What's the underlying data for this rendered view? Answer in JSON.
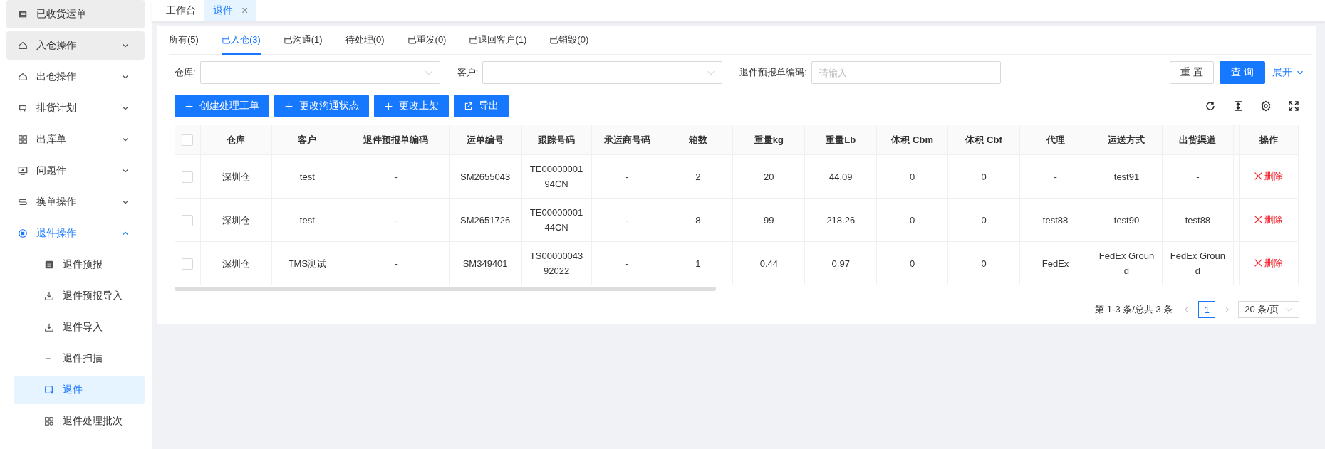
{
  "sidebar": {
    "items": [
      {
        "label": "已收货运单",
        "kind": "link",
        "highlighted": true,
        "selected": false
      },
      {
        "label": "入仓操作",
        "kind": "group",
        "highlighted": true,
        "expanded": false
      },
      {
        "label": "出仓操作",
        "kind": "group",
        "highlighted": false,
        "expanded": false
      },
      {
        "label": "排货计划",
        "kind": "group",
        "highlighted": false,
        "expanded": false
      },
      {
        "label": "出库单",
        "kind": "group",
        "highlighted": false,
        "expanded": false
      },
      {
        "label": "问题件",
        "kind": "group",
        "highlighted": false,
        "expanded": false
      },
      {
        "label": "换单操作",
        "kind": "group",
        "highlighted": false,
        "expanded": false
      },
      {
        "label": "退件操作",
        "kind": "group",
        "highlighted": false,
        "expanded": true,
        "children": [
          {
            "label": "退件预报",
            "selected": false
          },
          {
            "label": "退件预报导入",
            "selected": false
          },
          {
            "label": "退件导入",
            "selected": false
          },
          {
            "label": "退件扫描",
            "selected": false
          },
          {
            "label": "退件",
            "selected": true
          },
          {
            "label": "退件处理批次",
            "selected": false
          }
        ]
      }
    ]
  },
  "page_tabs": [
    {
      "label": "工作台",
      "selected": false,
      "closable": false
    },
    {
      "label": "退件",
      "selected": true,
      "closable": true,
      "close": "×"
    }
  ],
  "status_tabs": [
    {
      "label": "所有(5)",
      "selected": false
    },
    {
      "label": "已入仓(3)",
      "selected": true
    },
    {
      "label": "已沟通(1)",
      "selected": false
    },
    {
      "label": "待处理(0)",
      "selected": false
    },
    {
      "label": "已重发(0)",
      "selected": false
    },
    {
      "label": "已退回客户(1)",
      "selected": false
    },
    {
      "label": "已销毁(0)",
      "selected": false
    }
  ],
  "filters": [
    {
      "label": "仓库:",
      "kind": "select"
    },
    {
      "label": "客户:",
      "kind": "select"
    },
    {
      "label": "退件预报单编码:",
      "kind": "input",
      "placeholder": "请输入"
    }
  ],
  "filter_buttons": {
    "reset": "重 置",
    "query": "查 询",
    "expand": "展开"
  },
  "actions": [
    {
      "label": "创建处理工单",
      "kind": "add"
    },
    {
      "label": "更改沟通状态",
      "kind": "add"
    },
    {
      "label": "更改上架",
      "kind": "add"
    },
    {
      "label": "导出",
      "kind": "export"
    }
  ],
  "table": {
    "select_all": {
      "checked": false
    },
    "columns": [
      "仓库",
      "客户",
      "退件预报单编码",
      "运单编号",
      "跟踪号码",
      "承运商号码",
      "箱数",
      "重量kg",
      "重量Lb",
      "体积 Cbm",
      "体积 Cbf",
      "代理",
      "运送方式",
      "出货渠道",
      "操作"
    ],
    "rows": [
      {
        "checked": false,
        "cells": [
          "深圳仓",
          "test",
          "-",
          "SM2655043",
          "TE0000000194CN",
          "-",
          "2",
          "20",
          "44.09",
          "0",
          "0",
          "-",
          "test91",
          "-"
        ],
        "action": "删除"
      },
      {
        "checked": false,
        "cells": [
          "深圳仓",
          "test",
          "-",
          "SM2651726",
          "TE0000000144CN",
          "-",
          "8",
          "99",
          "218.26",
          "0",
          "0",
          "test88",
          "test90",
          "test88"
        ],
        "action": "删除"
      },
      {
        "checked": false,
        "cells": [
          "深圳仓",
          "TMS测试",
          "-",
          "SM349401",
          "TS0000004392022",
          "-",
          "1",
          "0.44",
          "0.97",
          "0",
          "0",
          "FedEx",
          "FedEx Ground",
          "FedEx Ground"
        ],
        "action": "删除"
      }
    ]
  },
  "pagination": {
    "summary": "第 1-3 条/总共 3 条",
    "pages": [
      {
        "label": "1",
        "selected": true
      }
    ],
    "page_size": "20 条/页"
  }
}
